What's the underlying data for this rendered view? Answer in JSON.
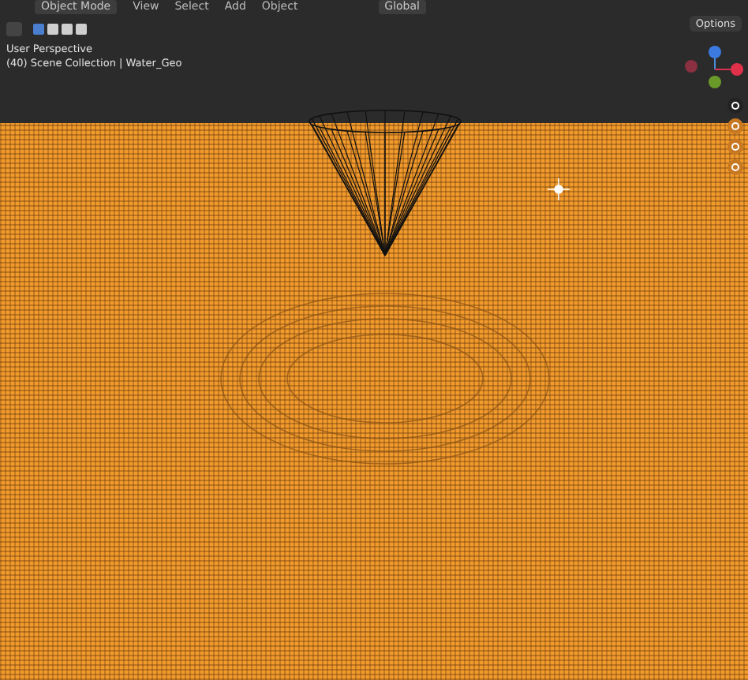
{
  "header": {
    "mode": "Object Mode",
    "menus": [
      "View",
      "Select",
      "Add",
      "Object"
    ],
    "orientation": "Global"
  },
  "select_modes": [
    {
      "selected": true
    },
    {
      "selected": false
    },
    {
      "selected": false
    },
    {
      "selected": false
    }
  ],
  "options": "Options",
  "viewport_info": {
    "view_name": "User Perspective",
    "context": "(40) Scene Collection | Water_Geo"
  }
}
